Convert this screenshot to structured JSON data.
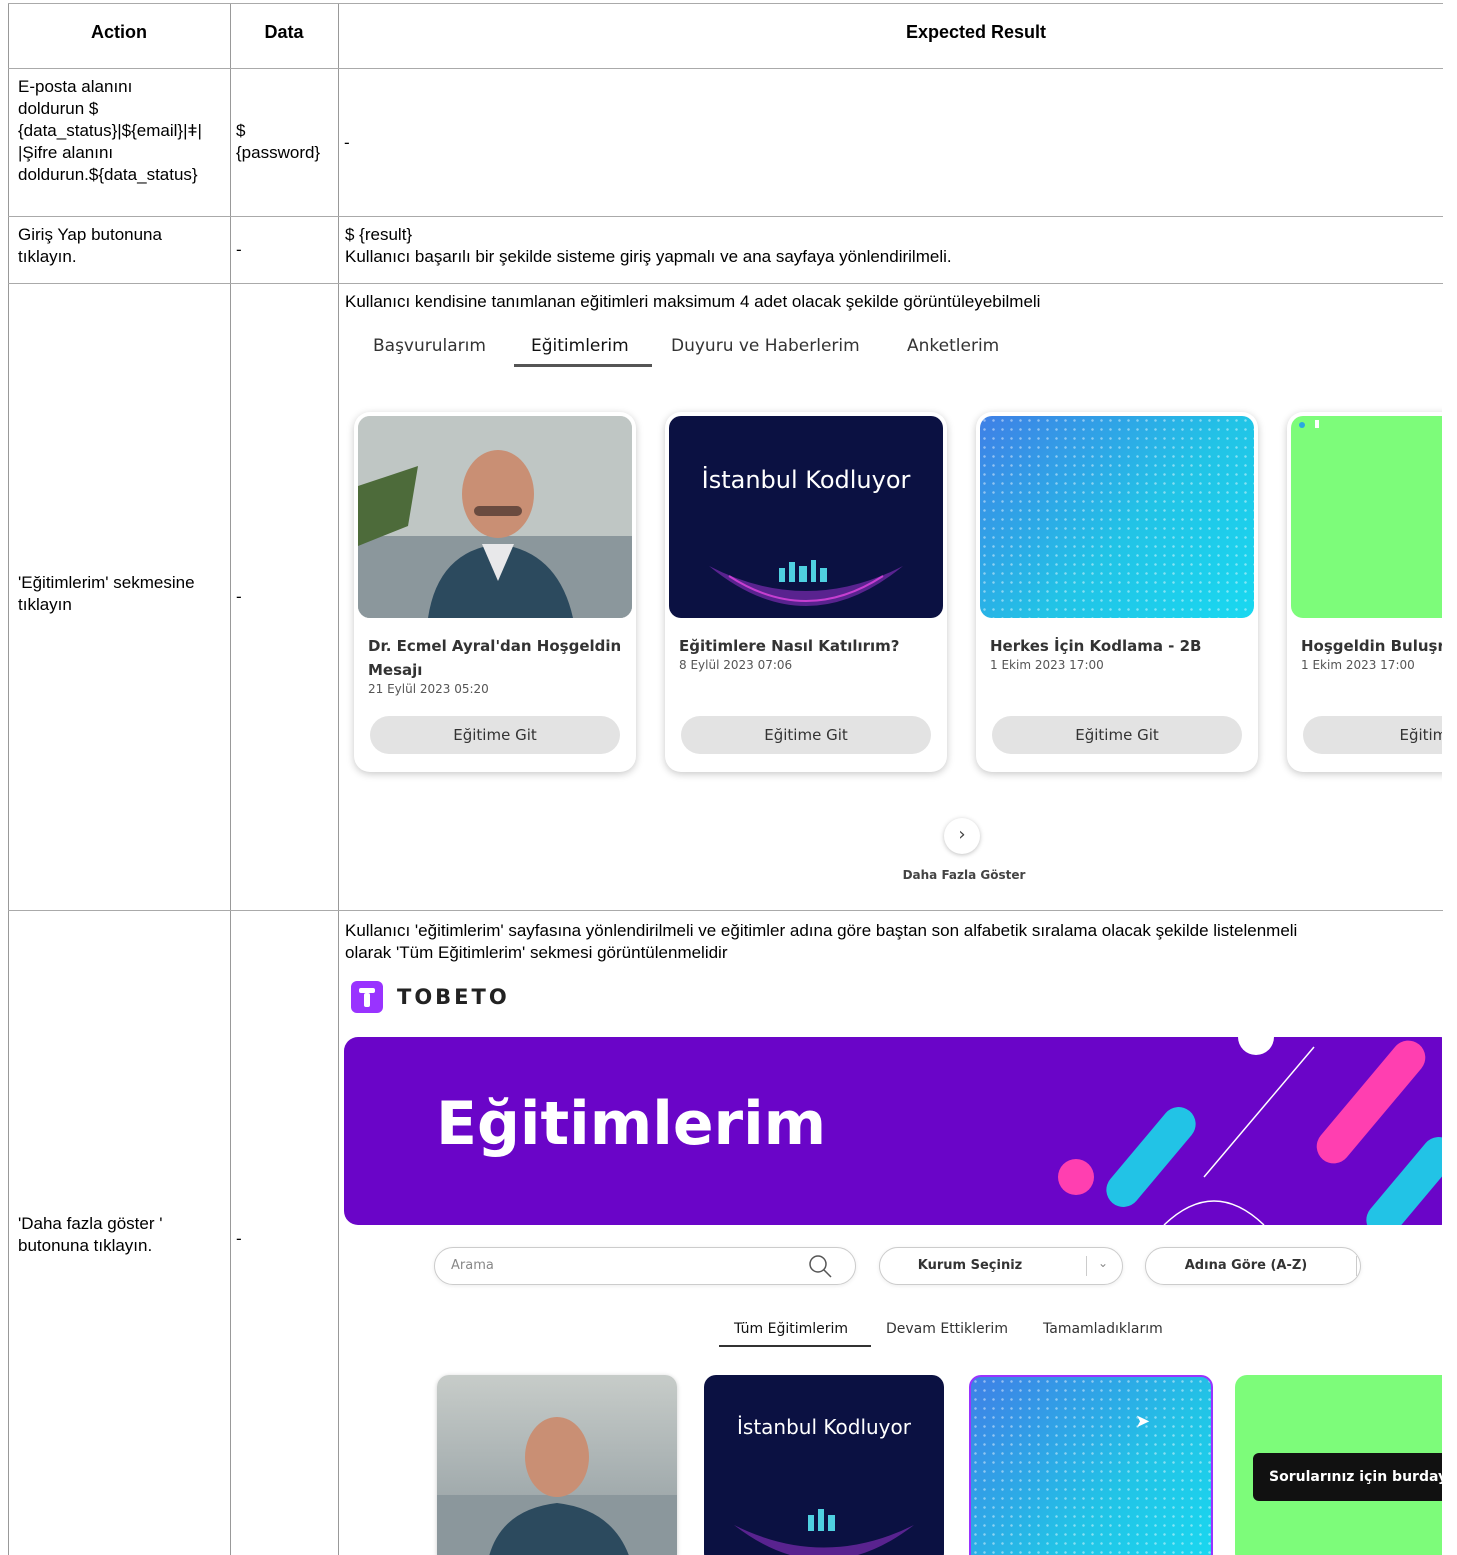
{
  "headers": {
    "action": "Action",
    "data": "Data",
    "expected": "Expected Result"
  },
  "rows": [
    {
      "action_lines": [
        "E-posta alanını",
        "doldurun $",
        "{data_status}|${email}|ǂ|",
        "|Şifre alanını",
        "doldurun.${data_status}"
      ],
      "data_lines": [
        "$",
        "{password}"
      ],
      "expected": "-"
    },
    {
      "action_lines": [
        "Giriş Yap butonuna",
        "tıklayın."
      ],
      "data": "-",
      "expected_lines": [
        "$ {result}",
        "Kullanıcı başarılı bir şekilde sisteme giriş yapmalı ve ana sayfaya yönlendirilmeli."
      ]
    },
    {
      "action_lines": [
        "'Eğitimlerim' sekmesine",
        "tıklayın"
      ],
      "data": "-",
      "expected": "Kullanıcı kendisine tanımlanan eğitimleri maksimum 4 adet olacak şekilde görüntüleyebilmeli"
    },
    {
      "action_lines": [
        "'Daha fazla göster '",
        "butonuna tıklayın."
      ],
      "data": "-",
      "expected_lines": [
        "Kullanıcı 'eğitimlerim' sayfasına yönlendirilmeli ve eğitimler adına göre baştan son alfabetik sıralama olacak şekilde listelenmeli",
        "olarak 'Tüm Eğitimlerim' sekmesi görüntülenmelidir"
      ]
    }
  ],
  "screen1": {
    "tabs": [
      "Başvurularım",
      "Eğitimlerim",
      "Duyuru ve Haberlerim",
      "Anketlerim"
    ],
    "active_tab": "Eğitimlerim",
    "cards": [
      {
        "title": "Dr. Ecmel Ayral'dan Hoşgeldin Mesajı",
        "date": "21 Eylül 2023 05:20",
        "button": "Eğitime Git"
      },
      {
        "title": "Eğitimlere Nasıl Katılırım?",
        "date": "8 Eylül 2023 07:06",
        "button": "Eğitime Git",
        "thumb_text": "İstanbul Kodluyor"
      },
      {
        "title": "Herkes İçin Kodlama - 2B",
        "date": "1 Ekim 2023 17:00",
        "button": "Eğitime Git"
      },
      {
        "title": "Hoşgeldin Buluşr",
        "date": "1 Ekim 2023 17:00",
        "button": "Eğitime"
      }
    ],
    "more_label": "Daha Fazla Göster"
  },
  "screen2": {
    "brand": "TOBETO",
    "banner_title": "Eğitimlerim",
    "search_placeholder": "Arama",
    "institution_select": "Kurum Seçiniz",
    "sort_select": "Adına Göre (A-Z)",
    "tabs": [
      "Tüm Eğitimlerim",
      "Devam Ettiklerim",
      "Tamamladıklarım"
    ],
    "active_tab": "Tüm Eğitimlerim",
    "card2_thumb_text": "İstanbul Kodluyor",
    "chat_label": "Sorularınız için burdayı"
  },
  "colors": {
    "purple": "#6a05c8",
    "green": "#7dfc7a",
    "navy": "#0b1142",
    "cyan": "#22c3e6"
  }
}
